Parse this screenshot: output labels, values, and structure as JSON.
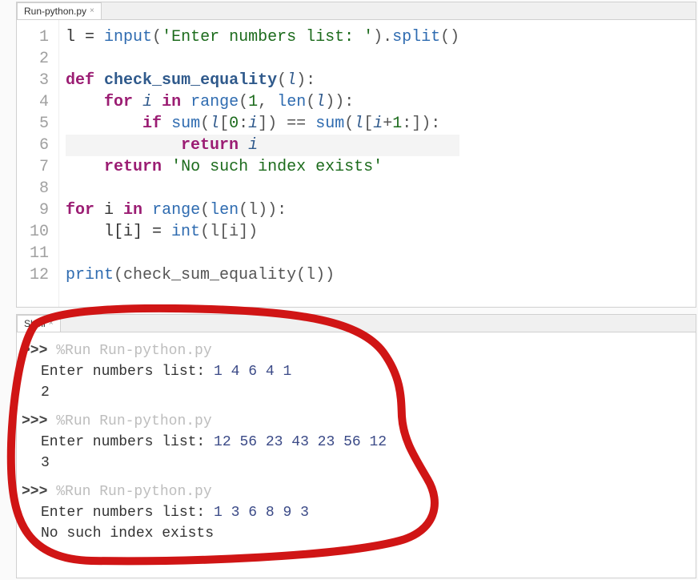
{
  "editor": {
    "tab": {
      "title": "Run-python.py"
    },
    "code": [
      {
        "n": 1,
        "t": [
          [
            "",
            "l = "
          ],
          [
            "fn",
            "input"
          ],
          [
            "op",
            "("
          ],
          [
            "str",
            "'Enter numbers list: '"
          ],
          [
            "op",
            ")."
          ],
          [
            "fn",
            "split"
          ],
          [
            "op",
            "()"
          ]
        ]
      },
      {
        "n": 2,
        "t": [
          [
            "",
            ""
          ]
        ]
      },
      {
        "n": 3,
        "t": [
          [
            "kw",
            "def"
          ],
          [
            "",
            " "
          ],
          [
            "fndef",
            "check_sum_equality"
          ],
          [
            "op",
            "("
          ],
          [
            "id",
            "l"
          ],
          [
            "op",
            "):"
          ]
        ]
      },
      {
        "n": 4,
        "t": [
          [
            "",
            "    "
          ],
          [
            "kw",
            "for"
          ],
          [
            "",
            " "
          ],
          [
            "id",
            "i"
          ],
          [
            "",
            " "
          ],
          [
            "kw",
            "in"
          ],
          [
            "",
            " "
          ],
          [
            "fn",
            "range"
          ],
          [
            "op",
            "("
          ],
          [
            "num",
            "1"
          ],
          [
            "op",
            ", "
          ],
          [
            "fn",
            "len"
          ],
          [
            "op",
            "("
          ],
          [
            "id",
            "l"
          ],
          [
            "op",
            ")):"
          ]
        ]
      },
      {
        "n": 5,
        "t": [
          [
            "",
            "        "
          ],
          [
            "kw",
            "if"
          ],
          [
            "",
            " "
          ],
          [
            "fn",
            "sum"
          ],
          [
            "op",
            "("
          ],
          [
            "id",
            "l"
          ],
          [
            "op",
            "["
          ],
          [
            "num",
            "0"
          ],
          [
            "op",
            ":"
          ],
          [
            "id",
            "i"
          ],
          [
            "op",
            "]) == "
          ],
          [
            "fn",
            "sum"
          ],
          [
            "op",
            "("
          ],
          [
            "id",
            "l"
          ],
          [
            "op",
            "["
          ],
          [
            "id",
            "i"
          ],
          [
            "op",
            "+"
          ],
          [
            "num",
            "1"
          ],
          [
            "op",
            ":]):"
          ]
        ]
      },
      {
        "n": 6,
        "hl": true,
        "t": [
          [
            "",
            "            "
          ],
          [
            "kw",
            "return"
          ],
          [
            "",
            " "
          ],
          [
            "id",
            "i"
          ]
        ]
      },
      {
        "n": 7,
        "t": [
          [
            "",
            "    "
          ],
          [
            "kw",
            "return"
          ],
          [
            "",
            " "
          ],
          [
            "str",
            "'No such index exists'"
          ]
        ]
      },
      {
        "n": 8,
        "t": [
          [
            "",
            ""
          ]
        ]
      },
      {
        "n": 9,
        "t": [
          [
            "kw",
            "for"
          ],
          [
            "",
            " i "
          ],
          [
            "kw",
            "in"
          ],
          [
            "",
            " "
          ],
          [
            "fn",
            "range"
          ],
          [
            "op",
            "("
          ],
          [
            "fn",
            "len"
          ],
          [
            "op",
            "(l)):"
          ]
        ]
      },
      {
        "n": 10,
        "t": [
          [
            "",
            "    l[i] = "
          ],
          [
            "fn",
            "int"
          ],
          [
            "op",
            "(l[i])"
          ]
        ]
      },
      {
        "n": 11,
        "t": [
          [
            "",
            ""
          ]
        ]
      },
      {
        "n": 12,
        "t": [
          [
            "fn",
            "print"
          ],
          [
            "op",
            "(check_sum_equality(l))"
          ]
        ]
      }
    ]
  },
  "shell": {
    "tab": {
      "title": "Shell"
    },
    "prompt": ">>>",
    "runs": [
      {
        "cmd": "%Run Run-python.py",
        "lines": [
          {
            "prompt": "Enter numbers list: ",
            "value": "1 4 6 4 1"
          },
          {
            "text": "2"
          }
        ]
      },
      {
        "cmd": "%Run Run-python.py",
        "lines": [
          {
            "prompt": "Enter numbers list: ",
            "value": "12 56 23 43 23 56 12"
          },
          {
            "text": "3"
          }
        ]
      },
      {
        "cmd": "%Run Run-python.py",
        "lines": [
          {
            "prompt": "Enter numbers list: ",
            "value": "1 3 6 8 9 3"
          },
          {
            "text": "No such index exists"
          }
        ]
      }
    ]
  }
}
